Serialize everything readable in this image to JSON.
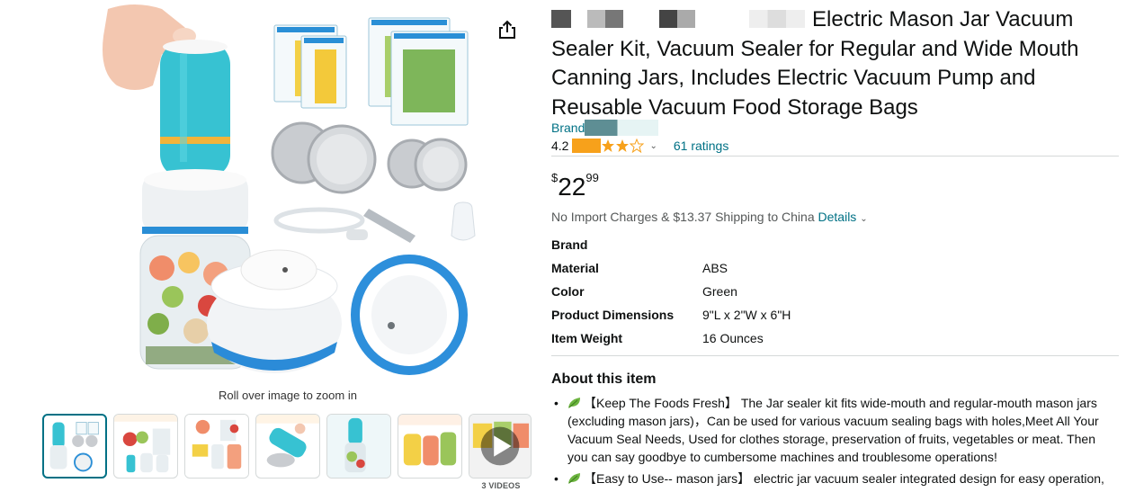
{
  "product": {
    "title_rest": "Electric Mason Jar Vacuum Sealer Kit, Vacuum Sealer for Regular and Wide Mouth Canning Jars, Includes Electric Vacuum Pump and Reusable Vacuum Food Storage Bags",
    "title_line1": "Electric Mason Jar Vacuum",
    "title_line2": "Sealer Kit, Vacuum Sealer for Regular and Wide Mouth",
    "title_line3": "Canning Jars, Includes Electric Vacuum Pump and",
    "title_line4": "Reusable Vacuum Food Storage Bags",
    "brand_prefix": "Brand",
    "rating_value": "4.2",
    "rating_stars": 4.2,
    "ratings_count": "61 ratings",
    "price_symbol": "$",
    "price_whole": "22",
    "price_fraction": "99",
    "shipping_text": "No Import Charges & $13.37 Shipping to China",
    "shipping_details": "Details"
  },
  "specs": [
    {
      "key": "Brand",
      "value": ""
    },
    {
      "key": "Material",
      "value": "ABS"
    },
    {
      "key": "Color",
      "value": "Green"
    },
    {
      "key": "Product Dimensions",
      "value": "9\"L x 2\"W x 6\"H"
    },
    {
      "key": "Item Weight",
      "value": "16 Ounces"
    }
  ],
  "about": {
    "title": "About this item",
    "bullets": [
      "【Keep The Foods Fresh】 The Jar sealer kit fits wide-mouth and regular-mouth mason jars (excluding mason jars)，Can be used for various vacuum sealing bags with holes,Meet All Your Vacuum Seal Needs, Used for clothes storage, preservation of fruits, vegetables or meat. Then you can say goodbye to cumbersome machines and troublesome operations!",
      "【Easy to Use-- mason jars】 electric jar vacuum sealer integrated design for easy operation,"
    ]
  },
  "gallery": {
    "zoom_hint": "Roll over image to zoom in",
    "video_label": "3 VIDEOS"
  },
  "colors": {
    "link": "#007185",
    "star": "#f7a11b",
    "accent_teal": "#34c1d1"
  }
}
